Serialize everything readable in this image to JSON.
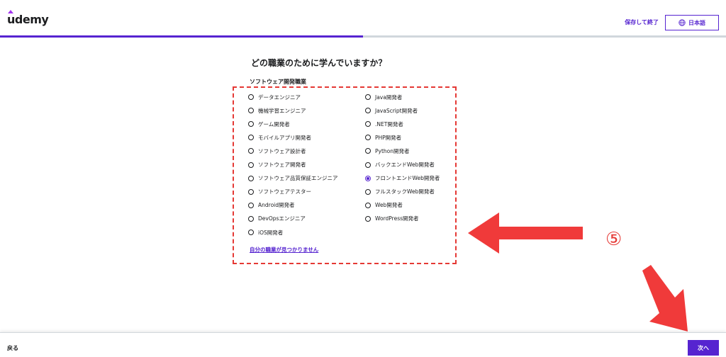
{
  "header": {
    "logo_text": "udemy",
    "save_exit": "保存して終了",
    "language": "日本語"
  },
  "progress": {
    "percent": 50
  },
  "question": "どの職業のために学んでいますか？",
  "group_title": "ソフトウェア開発職業",
  "options_left": [
    "データエンジニア",
    "機械学習エンジニア",
    "ゲーム開発者",
    "モバイルアプリ開発者",
    "ソフトウェア設計者",
    "ソフトウェア開発者",
    "ソフトウェア品質保証エンジニア",
    "ソフトウェアテスター",
    "Android開発者",
    "DevOpsエンジニア",
    "iOS開発者"
  ],
  "options_right": [
    "Java開発者",
    "JavaScript開発者",
    ".NET開発者",
    "PHP開発者",
    "Python開発者",
    "バックエンドWeb開発者",
    "フロントエンドWeb開発者",
    "フルスタックWeb開発者",
    "Web開発者",
    "WordPress開発者"
  ],
  "selected": "フロントエンドWeb開発者",
  "not_found_link": "自分の職業が見つかりません",
  "annotation": {
    "step_marker": "⑤",
    "color": "#e53935"
  },
  "footer": {
    "back": "戻る",
    "next": "次へ"
  },
  "colors": {
    "accent": "#5624d0",
    "annotation": "#e53935"
  }
}
